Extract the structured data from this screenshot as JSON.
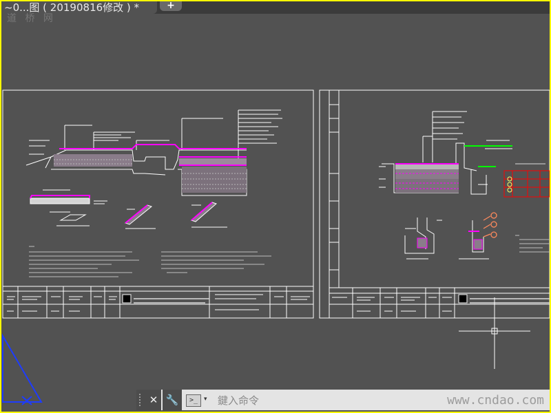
{
  "window": {
    "tab_title": "~0...图 ( 20190816修改 ) *",
    "add_tab_label": "+"
  },
  "watermarks": {
    "top": "道 桥 网",
    "bottom": "www.cndao.com"
  },
  "command_line": {
    "close_label": "✕",
    "settings_label": "🔧",
    "prompt_label": ">_",
    "recent_label": "▾",
    "placeholder": "鍵入命令"
  },
  "colors": {
    "canvas_background": "#525252",
    "window_border": "#ffff00",
    "drawing_lines": "#ffffff",
    "highlight": "#ff00ff",
    "annotations": "#00ff00",
    "table_grid": "#ff0000",
    "ucs_icon": "#1e3cff",
    "leader_balloons": "#ff8a5c"
  },
  "icons": [
    "close-icon",
    "wrench-icon",
    "command-prompt-icon",
    "crosshair-cursor-icon",
    "ucs-icon"
  ]
}
